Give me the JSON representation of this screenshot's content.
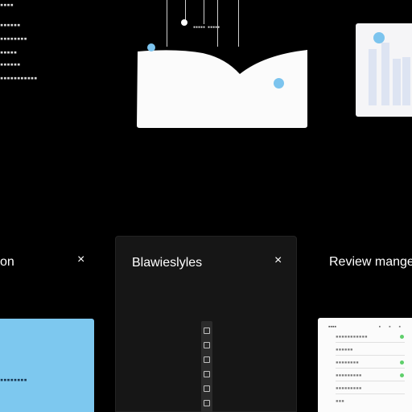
{
  "background_color": "#000000",
  "accent_blue": "#7cc4ee",
  "side_list": {
    "rows": [
      "▪▪▪▪",
      "▪▪▪▪▪▪",
      "▪▪▪▪▪▪▪▪",
      "▪▪▪▪▪",
      "▪▪▪▪▪▪",
      "▪▪▪▪▪▪▪▪▪▪▪"
    ]
  },
  "illustration": {
    "caption": "▪▪▪▪▪ ▪▪▪▪▪"
  },
  "cards": {
    "left": {
      "title": "on",
      "close_icon": "close-icon",
      "panel_label": "▪▪▪▪▪▪▪▪",
      "panel_color": "#7dc8ef"
    },
    "middle": {
      "title": "Blawieslyles",
      "close_icon": "close-icon"
    },
    "right": {
      "title": "Review mangep",
      "doc_header": "▪▪▪▪",
      "doc_header_icons": "▪ ▪ ▪",
      "items": [
        "▪▪▪▪▪▪▪▪▪▪▪",
        "▪▪▪▪▪▪",
        "▪▪▪▪▪▪▪▪",
        "▪▪▪▪▪▪▪▪▪",
        "▪▪▪▪▪▪▪▪▪",
        "▪▪▪"
      ],
      "status_green": "#5fcf6b"
    }
  }
}
